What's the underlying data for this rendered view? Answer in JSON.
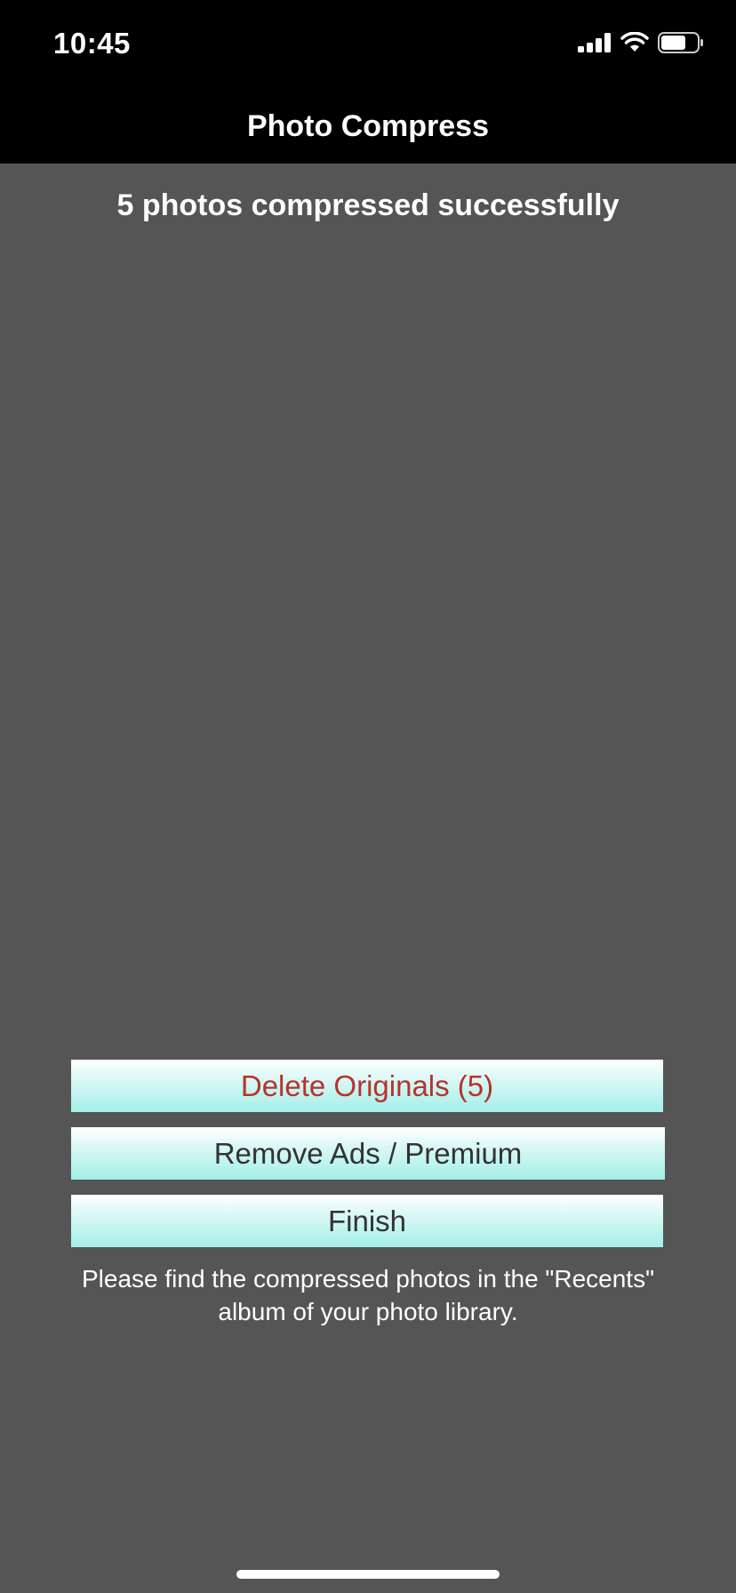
{
  "status_bar": {
    "time": "10:45",
    "icons": [
      "cellular-signal-icon",
      "wifi-icon",
      "battery-icon"
    ]
  },
  "nav": {
    "title": "Photo Compress"
  },
  "result": {
    "message": "5 photos compressed successfully"
  },
  "buttons": {
    "delete_label": "Delete Originals (5)",
    "premium_label": "Remove Ads / Premium",
    "finish_label": "Finish"
  },
  "info": {
    "line1": "Please find the compressed photos in the \"Recents\"",
    "line2": "album of your photo library."
  },
  "colors": {
    "background": "#555555",
    "bar": "#000000",
    "delete_text": "#b8322c",
    "button_gradient_top": "#ffffff",
    "button_gradient_bottom": "#a3efe8"
  }
}
